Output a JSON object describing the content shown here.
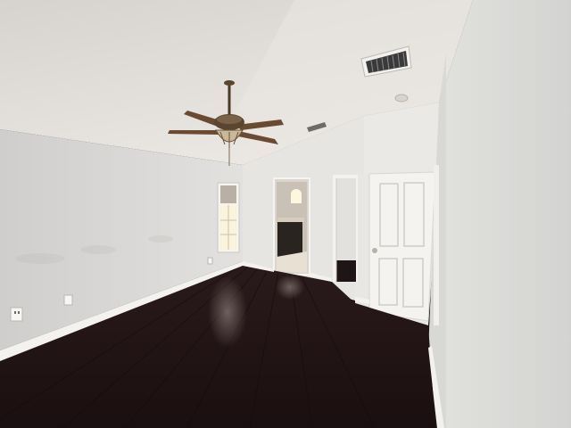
{
  "scene": {
    "type": "photo",
    "colors": {
      "ceiling": "#e4e1dc",
      "wall_left": "#d9d8d6",
      "wall_center": "#e6e4e0",
      "wall_right": "#dcdcda",
      "floor": "#241617",
      "baseboard": "#f3f2ef",
      "door": "#f4f3f0",
      "window_light": "#fbf3dc",
      "fan_blade": "#6b4a33",
      "fan_metal": "#5a4630",
      "vent": "#2b2b2b"
    }
  }
}
